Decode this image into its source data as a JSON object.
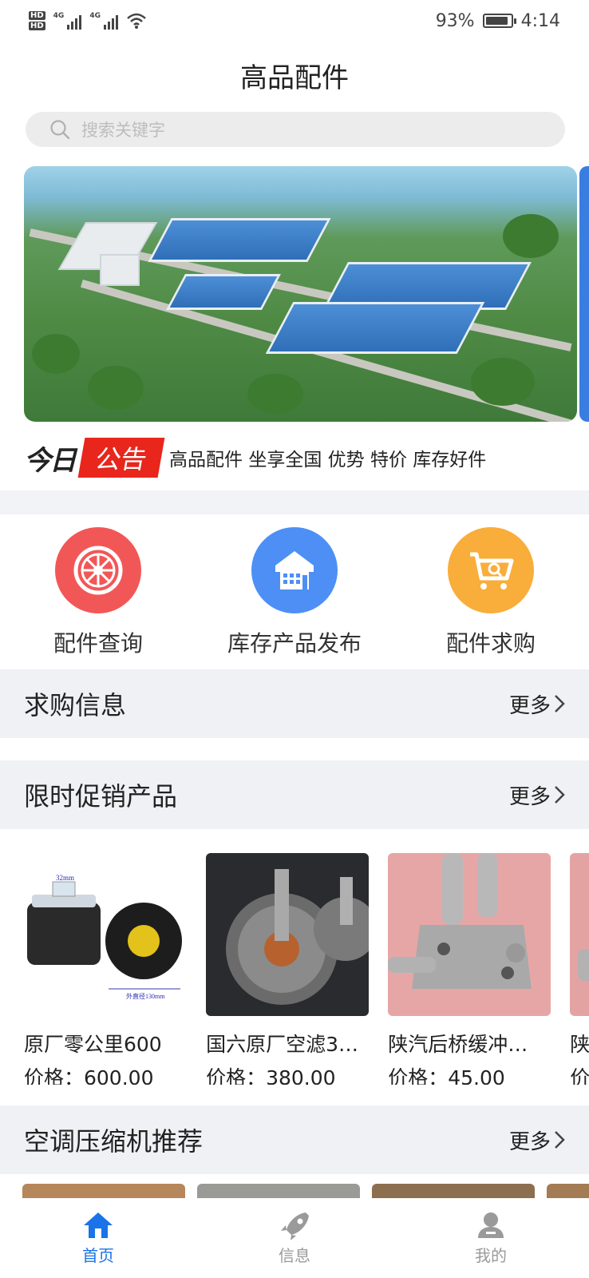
{
  "status": {
    "battery": "93%",
    "time": "4:14",
    "net1": "4G",
    "net2": "4G",
    "battery_level": 0.93
  },
  "header": {
    "title": "高品配件"
  },
  "search": {
    "placeholder": "搜索关键字"
  },
  "notice": {
    "prefix": "今日",
    "tag": "公告",
    "text": "高品配件 坐享全国 优势 特价 库存好件"
  },
  "features": [
    {
      "label": "配件查询",
      "icon": "wheel-icon",
      "color": "#f25757"
    },
    {
      "label": "库存产品发布",
      "icon": "warehouse-icon",
      "color": "#4d8ff5"
    },
    {
      "label": "配件求购",
      "icon": "cart-icon",
      "color": "#f9ad3a"
    }
  ],
  "sections": {
    "wanted": {
      "title": "求购信息",
      "more": "更多"
    },
    "promo": {
      "title": "限时促销产品",
      "more": "更多"
    },
    "compressor": {
      "title": "空调压缩机推荐",
      "more": "更多"
    }
  },
  "products": [
    {
      "name": "原厂零公里600",
      "price": "价格：600.00",
      "dim1": "32mm",
      "dim2": "外直径130mm"
    },
    {
      "name": "国六原厂空滤3…",
      "price": "价格：380.00"
    },
    {
      "name": "陕汽后桥缓冲…",
      "price": "价格：45.00"
    },
    {
      "name": "陕汽",
      "price": "价格"
    }
  ],
  "tabs": [
    {
      "label": "首页",
      "icon": "home-icon"
    },
    {
      "label": "信息",
      "icon": "rocket-icon"
    },
    {
      "label": "我的",
      "icon": "user-icon"
    }
  ],
  "colors": {
    "accent": "#1a73e8",
    "notice_red": "#e8261c",
    "inactive": "#9a9a9a"
  }
}
